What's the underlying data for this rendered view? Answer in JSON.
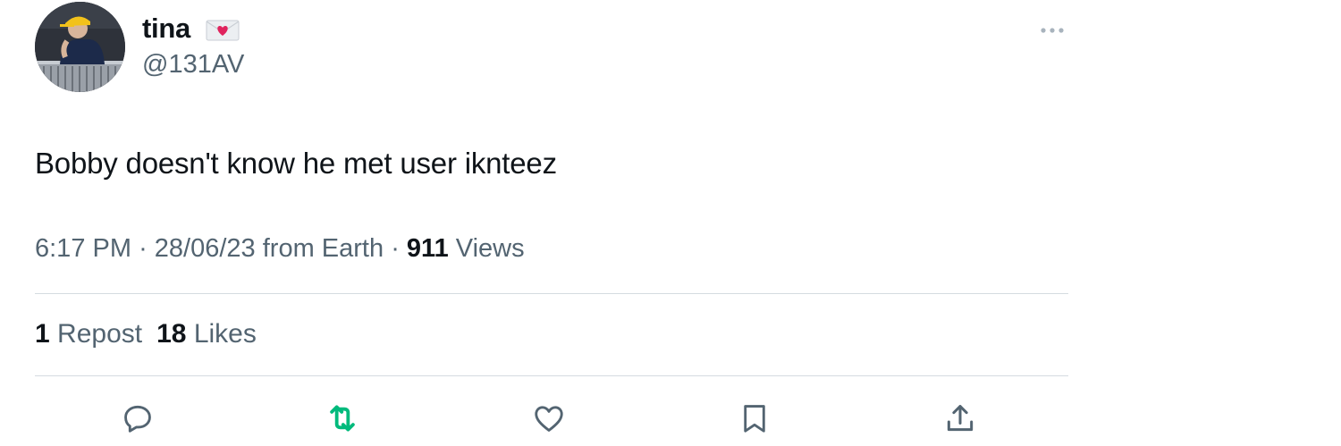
{
  "author": {
    "display_name": "tina",
    "name_emoji_icon": "envelope-with-heart-icon",
    "handle": "@131AV"
  },
  "tweet": {
    "text": "Bobby doesn't know he met user iknteez",
    "time": "6:17 PM",
    "separator": "·",
    "date_source": "28/06/23 from Earth",
    "views_count": "911",
    "views_label": "Views"
  },
  "stats": {
    "reposts_count": "1",
    "reposts_label": "Repost",
    "likes_count": "18",
    "likes_label": "Likes"
  },
  "actions": [
    {
      "icon": "reply-icon"
    },
    {
      "icon": "repost-icon",
      "color": "#00ba7c"
    },
    {
      "icon": "like-icon"
    },
    {
      "icon": "bookmark-icon"
    },
    {
      "icon": "share-icon"
    }
  ],
  "colors": {
    "text_primary": "#0f1419",
    "text_secondary": "#536471",
    "divider": "#d5dbe0",
    "repost_active": "#00ba7c",
    "icon_gray": "#536471"
  }
}
